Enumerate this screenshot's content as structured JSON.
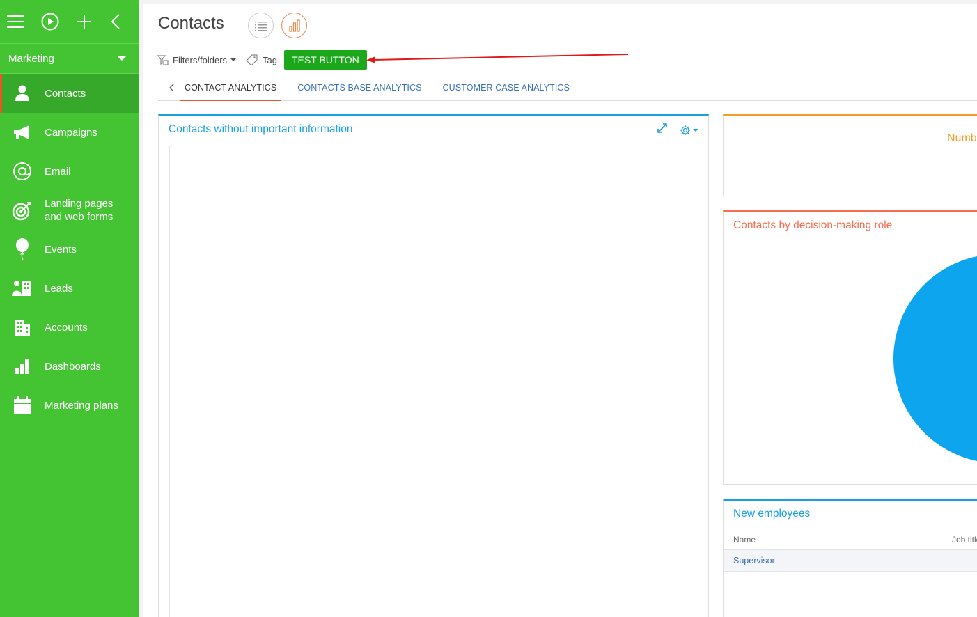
{
  "sidebar": {
    "workspace": "Marketing",
    "items": [
      {
        "label": "Contacts",
        "icon": "person-icon",
        "active": true
      },
      {
        "label": "Campaigns",
        "icon": "megaphone-icon"
      },
      {
        "label": "Email",
        "icon": "at-icon"
      },
      {
        "label": "Landing pages and web forms",
        "icon": "target-icon"
      },
      {
        "label": "Events",
        "icon": "balloon-icon"
      },
      {
        "label": "Leads",
        "icon": "leads-icon"
      },
      {
        "label": "Accounts",
        "icon": "building-icon"
      },
      {
        "label": "Dashboards",
        "icon": "bar-chart-icon"
      },
      {
        "label": "Marketing plans",
        "icon": "calendar-icon"
      }
    ]
  },
  "header": {
    "title": "Contacts"
  },
  "toolbar": {
    "filters_label": "Filters/folders",
    "tag_label": "Tag",
    "test_button_label": "TEST BUTTON"
  },
  "tabs": [
    {
      "label": "CONTACT ANALYTICS",
      "active": true
    },
    {
      "label": "CONTACTS BASE ANALYTICS"
    },
    {
      "label": "CUSTOMER CASE ANALYTICS"
    }
  ],
  "widgets": {
    "contacts_missing": {
      "title": "Contacts without important information"
    },
    "number": {
      "title": "Numb"
    },
    "decision_role": {
      "title": "Contacts by decision-making role"
    },
    "new_employees": {
      "title": "New employees",
      "columns": [
        "Name",
        "Job title"
      ],
      "rows": [
        {
          "name": "Supervisor"
        }
      ]
    }
  },
  "colors": {
    "sidebar_bg": "#44c433",
    "accent_orange": "#e8562a",
    "link_blue": "#3c71b5",
    "widget_blue": "#19a0e3",
    "test_button": "#1ba81b",
    "annotation_arrow": "#e01a1a"
  }
}
